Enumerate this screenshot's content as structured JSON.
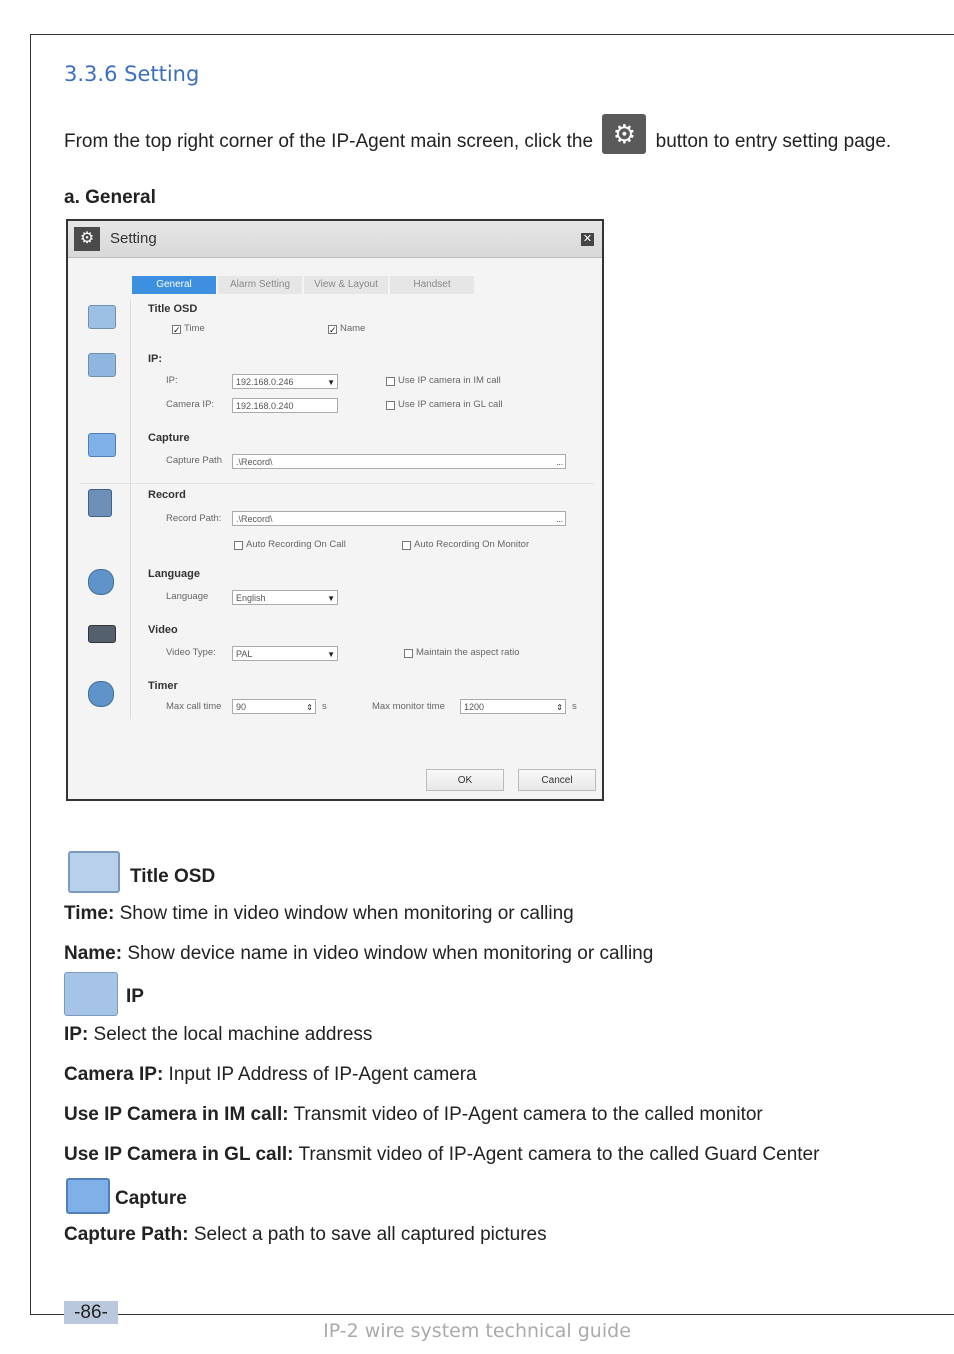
{
  "heading": "3.3.6 Setting",
  "intro": {
    "before": "From the top right corner of the IP-Agent main screen, click the",
    "after": "button to entry setting page."
  },
  "subheading": "a. General",
  "dialog": {
    "title": "Setting",
    "tabs": [
      "General",
      "Alarm Setting",
      "View & Layout",
      "Handset"
    ],
    "title_osd": {
      "label": "Title OSD",
      "time": "Time",
      "name": "Name"
    },
    "ip": {
      "label": "IP:",
      "ip_label": "IP:",
      "ip_value": "192.168.0.246",
      "camera_ip_label": "Camera IP:",
      "camera_ip_value": "192.168.0.240",
      "use_im": "Use IP camera in IM call",
      "use_gl": "Use IP camera in GL call"
    },
    "capture": {
      "label": "Capture",
      "path_label": "Capture Path",
      "path_value": ".\\Record\\"
    },
    "record": {
      "label": "Record",
      "path_label": "Record Path:",
      "path_value": ".\\Record\\",
      "auto_call": "Auto Recording On Call",
      "auto_monitor": "Auto Recording On Monitor"
    },
    "language": {
      "label": "Language",
      "field_label": "Language",
      "value": "English"
    },
    "video": {
      "label": "Video",
      "type_label": "Video Type:",
      "type_value": "PAL",
      "aspect": "Maintain the aspect ratio"
    },
    "timer": {
      "label": "Timer",
      "max_call_label": "Max call time",
      "max_call_value": "90",
      "unit": "s",
      "max_monitor_label": "Max monitor time",
      "max_monitor_value": "1200"
    },
    "ok": "OK",
    "cancel": "Cancel",
    "browse": "..."
  },
  "sections": {
    "title_osd": "Title OSD",
    "ip": "IP",
    "capture": "Capture"
  },
  "descriptions": [
    {
      "term": "Time:",
      "text": " Show time in video window when monitoring or calling"
    },
    {
      "term": "Name:",
      "text": " Show device name in video window when monitoring or calling"
    },
    {
      "term": "IP:",
      "text": " Select the local machine address"
    },
    {
      "term": "Camera IP:",
      "text": " Input IP Address of IP-Agent camera"
    },
    {
      "term": "Use IP Camera in IM call:",
      "text": " Transmit video of IP-Agent camera to the called monitor"
    },
    {
      "term": "Use IP Camera in GL call:",
      "text": " Transmit video of IP-Agent camera to the called Guard Center"
    },
    {
      "term": "Capture Path:",
      "text": " Select a path to save all captured pictures"
    }
  ],
  "page_number": "-86-",
  "footer": "IP-2 wire system technical guide",
  "colors": {
    "heading": "#3a6fc1",
    "tab_active": "#3d8fe0",
    "page_badge": "#b9c8dc"
  }
}
